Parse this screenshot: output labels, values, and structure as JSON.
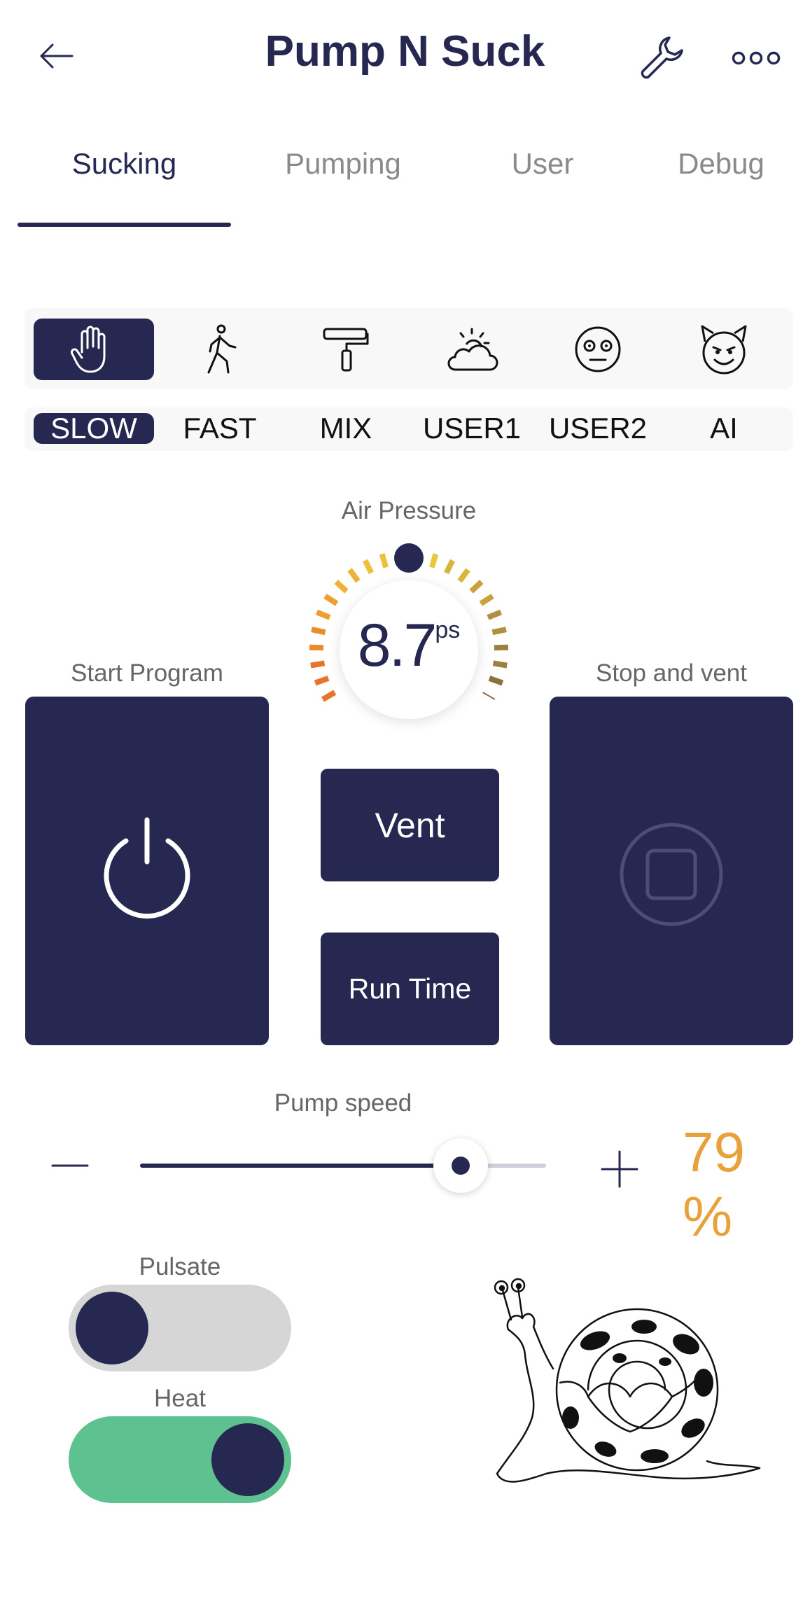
{
  "header": {
    "title": "Pump N Suck"
  },
  "tabs": [
    {
      "label": "Sucking",
      "active": true
    },
    {
      "label": "Pumping",
      "active": false
    },
    {
      "label": "User",
      "active": false
    },
    {
      "label": "Debug",
      "active": false
    }
  ],
  "modes": {
    "icons": [
      "hand-icon",
      "walking-person-icon",
      "paint-roller-icon",
      "cloudy-sun-icon",
      "flushed-face-icon",
      "devil-face-icon"
    ],
    "labels": [
      "SLOW",
      "FAST",
      "MIX",
      "USER1",
      "USER2",
      "AI"
    ],
    "selected_index": 0
  },
  "air_pressure": {
    "label": "Air Pressure",
    "value": "8.7",
    "unit": "ps"
  },
  "start": {
    "label": "Start Program"
  },
  "stop": {
    "label": "Stop and vent"
  },
  "vent": {
    "label": "Vent"
  },
  "run_time": {
    "label": "Run Time"
  },
  "pump_speed": {
    "label": "Pump speed",
    "value": 79,
    "value_text": "79 %"
  },
  "pulsate": {
    "label": "Pulsate",
    "on": false
  },
  "heat": {
    "label": "Heat",
    "on": true
  },
  "colors": {
    "primary": "#262852",
    "accent": "#e8a13b",
    "toggle_on": "#5dc190",
    "toggle_off": "#d6d6d6"
  }
}
